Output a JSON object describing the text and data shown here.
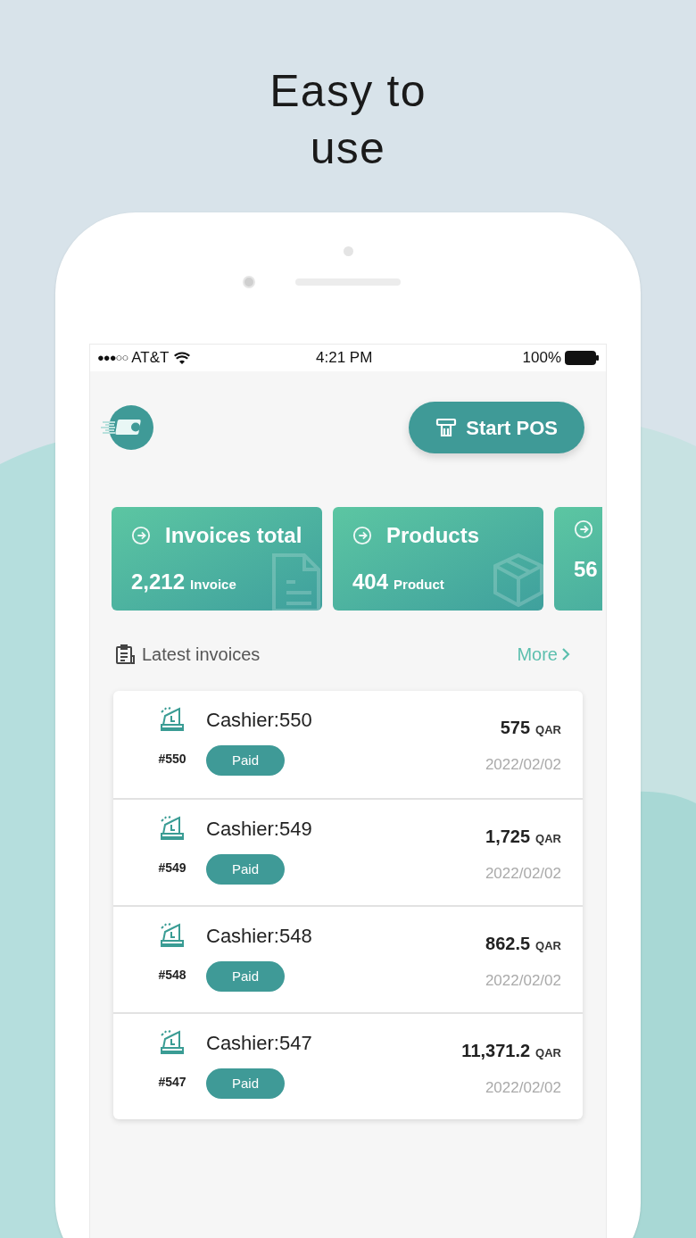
{
  "headline": [
    "Easy to",
    "use"
  ],
  "status_bar": {
    "signal": "●●●○○",
    "carrier": "AT&T",
    "time": "4:21 PM",
    "battery": "100%"
  },
  "header": {
    "button": "Start POS"
  },
  "stats": [
    {
      "title": "Invoices total",
      "value": "2,212",
      "unit": "Invoice",
      "kind": "document"
    },
    {
      "title": "Products",
      "value": "404",
      "unit": "Product",
      "kind": "box"
    },
    {
      "value": "56",
      "kind": "partial"
    }
  ],
  "latest": {
    "title": "Latest invoices",
    "more": "More"
  },
  "invoices": [
    {
      "cashier": "Cashier:550",
      "number": "#550",
      "status": "Paid",
      "amount": "575",
      "currency": "QAR",
      "date": "2022/02/02"
    },
    {
      "cashier": "Cashier:549",
      "number": "#549",
      "status": "Paid",
      "amount": "1,725",
      "currency": "QAR",
      "date": "2022/02/02"
    },
    {
      "cashier": "Cashier:548",
      "number": "#548",
      "status": "Paid",
      "amount": "862.5",
      "currency": "QAR",
      "date": "2022/02/02"
    },
    {
      "cashier": "Cashier:547",
      "number": "#547",
      "status": "Paid",
      "amount": "11,371.2",
      "currency": "QAR",
      "date": "2022/02/02"
    }
  ]
}
